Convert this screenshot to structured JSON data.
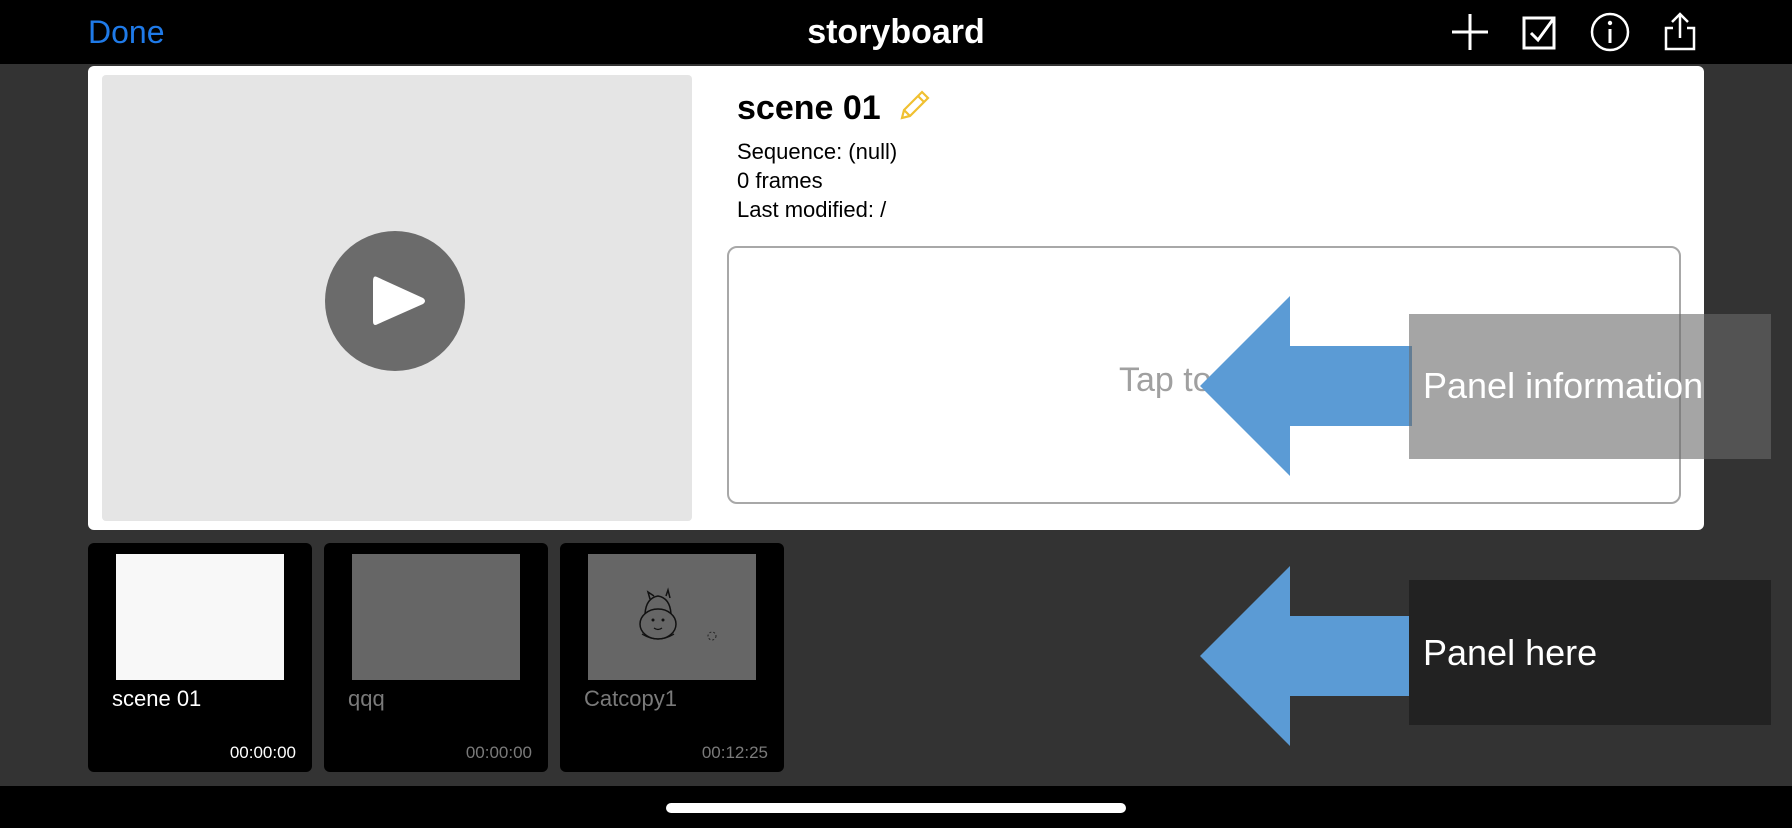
{
  "topbar": {
    "done_label": "Done",
    "title": "storyboard",
    "icons": [
      "plus-icon",
      "checkbox-icon",
      "info-icon",
      "share-icon"
    ]
  },
  "scene": {
    "name": "scene 01",
    "sequence": "Sequence: (null)",
    "frames": "0 frames",
    "last_modified": "Last modified: /",
    "notes_placeholder": "Tap to"
  },
  "panels": [
    {
      "name": "scene 01",
      "time": "00:00:00",
      "thumb_color": "#f8f8f8",
      "name_color": "#ffffff",
      "time_color": "#ffffff"
    },
    {
      "name": "qqq",
      "time": "00:00:00",
      "thumb_color": "#666666",
      "name_color": "#7a7a7a",
      "time_color": "#7a7a7a"
    },
    {
      "name": "Catcopy1",
      "time": "00:12:25",
      "thumb_color": "#666666",
      "name_color": "#7a7a7a",
      "time_color": "#7a7a7a"
    }
  ],
  "annotations": [
    {
      "label": "Panel information"
    },
    {
      "label": "Panel here"
    }
  ],
  "colors": {
    "accent": "#1f7ae8",
    "arrow": "#5b9bd5",
    "pencil": "#f0c030"
  }
}
